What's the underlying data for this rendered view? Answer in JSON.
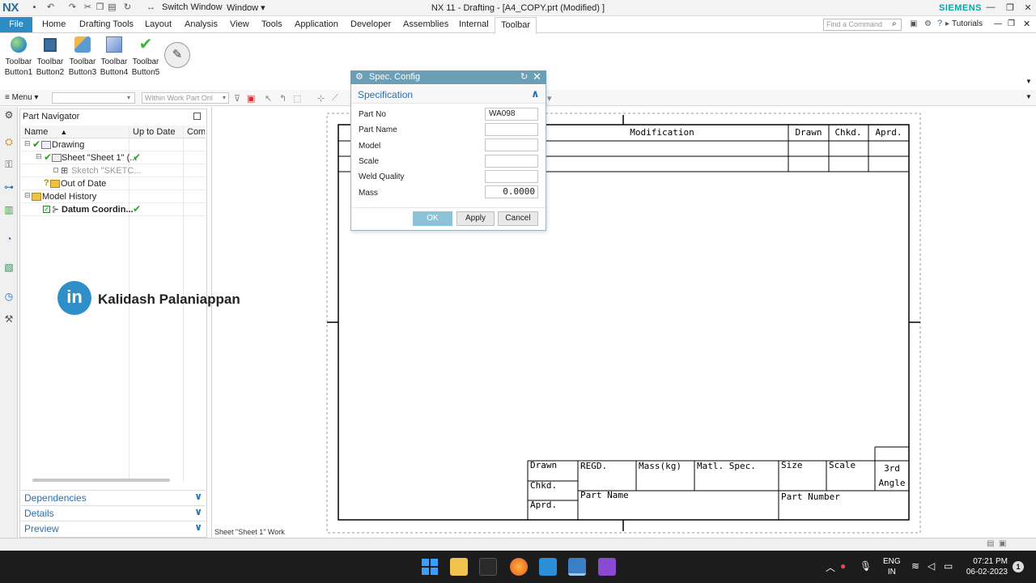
{
  "app": {
    "logo": "NX",
    "title": "NX 11 - Drafting - [A4_COPY.prt (Modified) ]",
    "brand": "SIEMENS",
    "switch_window": "Switch Window",
    "window_menu": "Window",
    "find_command_placeholder": "Find a Command",
    "tutorials": "Tutorials"
  },
  "ribbon": {
    "tabs": [
      "File",
      "Home",
      "Drafting Tools",
      "Layout",
      "Analysis",
      "View",
      "Tools",
      "Application",
      "Developer",
      "Assemblies",
      "Internal",
      "Toolbar"
    ],
    "active_tab": "Toolbar",
    "buttons": [
      {
        "label1": "Toolbar",
        "label2": "Button1"
      },
      {
        "label1": "Toolbar",
        "label2": "Button2"
      },
      {
        "label1": "Toolbar",
        "label2": "Button3"
      },
      {
        "label1": "Toolbar",
        "label2": "Button4"
      },
      {
        "label1": "Toolbar",
        "label2": "Button5"
      }
    ]
  },
  "cmdbar": {
    "menu": "Menu",
    "filter_value": "",
    "scope_value": "Within Work Part Onl"
  },
  "part_navigator": {
    "title": "Part Navigator",
    "columns": [
      "Name",
      "Up to Date",
      "Comm"
    ],
    "rows": [
      {
        "label": "Drawing",
        "check": "✔"
      },
      {
        "label": "Sheet \"Sheet 1\" (...",
        "check": "✔"
      },
      {
        "label": "Sketch \"SKETC...",
        "check": ""
      },
      {
        "label": "Out of Date",
        "check": ""
      },
      {
        "label": "Model History",
        "check": ""
      },
      {
        "label": "Datum Coordin...",
        "check": "✔"
      }
    ],
    "sections": [
      "Dependencies",
      "Details",
      "Preview"
    ]
  },
  "watermark": {
    "badge": "in",
    "name": "Kalidash Palaniappan"
  },
  "graphics": {
    "sheet_label": "Sheet \"Sheet 1\" Work"
  },
  "drawing": {
    "revision_headers": [
      "Modification",
      "Drawn",
      "Chkd.",
      "Aprd."
    ],
    "title_block": {
      "drawn": "Drawn",
      "chkd": "Chkd.",
      "aprd": "Aprd.",
      "regd": "REGD.",
      "mass": "Mass(kg)",
      "matl": "Matl. Spec.",
      "size": "Size",
      "scale": "Scale",
      "angle1": "3rd",
      "angle2": "Angle",
      "part_name": "Part Name",
      "part_number": "Part Number"
    }
  },
  "dialog": {
    "title": "Spec. Config",
    "section": "Specification",
    "fields": [
      {
        "label": "Part No",
        "value": "WA098"
      },
      {
        "label": "Part Name",
        "value": ""
      },
      {
        "label": "Model",
        "value": ""
      },
      {
        "label": "Scale",
        "value": ""
      },
      {
        "label": "Weld Quality",
        "value": ""
      },
      {
        "label": "Mass",
        "value": "0.0000"
      }
    ],
    "buttons": {
      "ok": "OK",
      "apply": "Apply",
      "cancel": "Cancel"
    }
  },
  "taskbar": {
    "lang1": "ENG",
    "lang2": "IN",
    "time": "07:21 PM",
    "date": "06-02-2023",
    "notifications": "1"
  },
  "colors": {
    "accent": "#2f8bc4",
    "dialog_title": "#6a9fb5",
    "ok_button": "#8cc3d8",
    "check": "#22a622",
    "brand": "#0aa5a5"
  }
}
